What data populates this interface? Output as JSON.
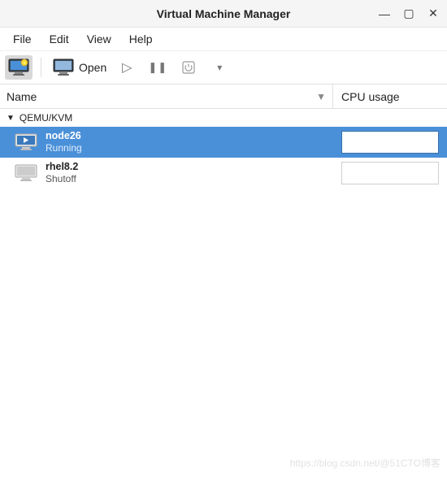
{
  "window": {
    "title": "Virtual Machine Manager",
    "controls": {
      "minimize": "—",
      "maximize": "▢",
      "close": "✕"
    }
  },
  "menubar": {
    "items": [
      "File",
      "Edit",
      "View",
      "Help"
    ]
  },
  "toolbar": {
    "new_vm": "new-vm",
    "open_label": "Open",
    "run": "▷",
    "pause": "❚❚",
    "shutdown": "⏻",
    "dropdown": "▾"
  },
  "columns": {
    "name": "Name",
    "cpu": "CPU usage",
    "sort_arrow": "▼"
  },
  "connection": {
    "label": "QEMU/KVM",
    "expanded_arrow": "▼"
  },
  "vms": [
    {
      "name": "node26",
      "state": "Running",
      "selected": true,
      "running": true
    },
    {
      "name": "rhel8.2",
      "state": "Shutoff",
      "selected": false,
      "running": false
    }
  ],
  "watermark": "https://blog.csdn.net/@51CTO博客"
}
